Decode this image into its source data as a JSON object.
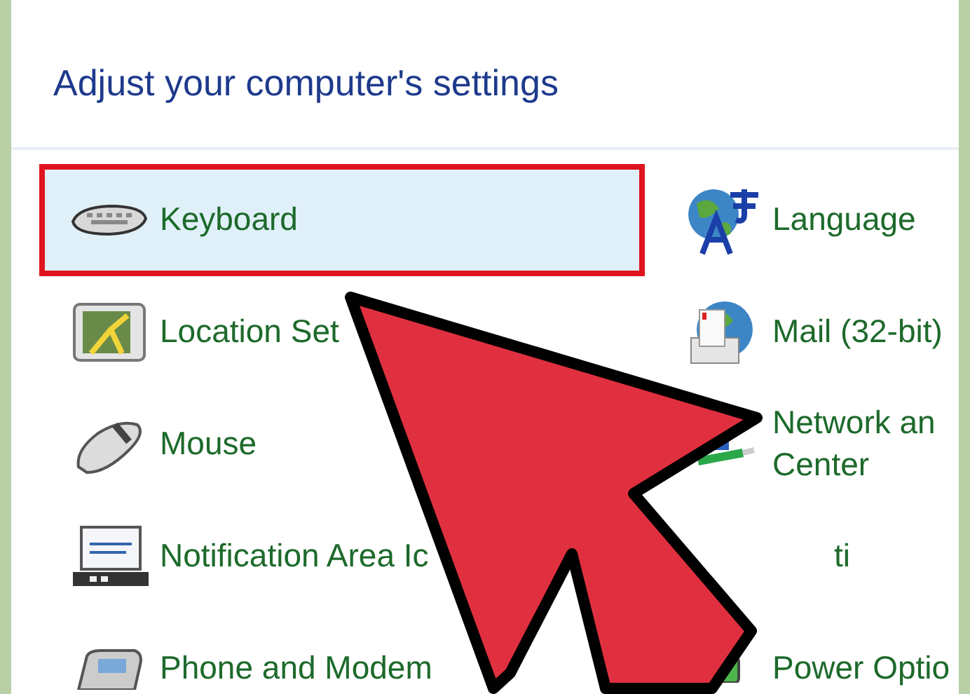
{
  "title": "Adjust your computer's settings",
  "left_items": [
    {
      "label": "Keyboard",
      "selected": true
    },
    {
      "label": "Location Set",
      "selected": false
    },
    {
      "label": "Mouse",
      "selected": false
    },
    {
      "label": "Notification Area Ic",
      "selected": false
    },
    {
      "label": "Phone and Modem",
      "selected": false
    }
  ],
  "right_items": [
    {
      "lines": [
        "Language"
      ],
      "selected": false
    },
    {
      "lines": [
        "Mail (32-bit)"
      ],
      "selected": false
    },
    {
      "lines": [
        "Network an",
        "Center"
      ],
      "selected": false
    },
    {
      "lines": [
        "ti"
      ],
      "selected": false
    },
    {
      "lines": [
        "Power Optio"
      ],
      "selected": false
    }
  ]
}
